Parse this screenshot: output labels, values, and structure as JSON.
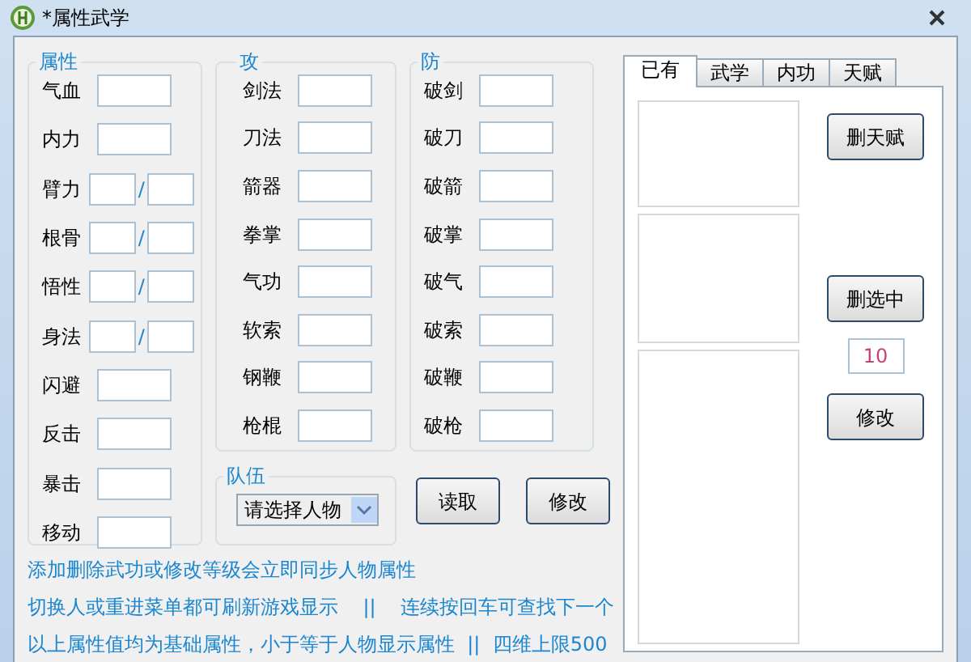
{
  "window": {
    "title": "*属性武学"
  },
  "groups": [
    {
      "title": "属性",
      "rows": [
        {
          "label": "气血",
          "kind": "single"
        },
        {
          "label": "内力",
          "kind": "single"
        },
        {
          "label": "臂力",
          "kind": "pair",
          "separator": "/"
        },
        {
          "label": "根骨",
          "kind": "pair",
          "separator": "/"
        },
        {
          "label": "悟性",
          "kind": "pair",
          "separator": "/"
        },
        {
          "label": "身法",
          "kind": "pair",
          "separator": "/"
        },
        {
          "label": "闪避",
          "kind": "single"
        },
        {
          "label": "反击",
          "kind": "single"
        },
        {
          "label": "暴击",
          "kind": "single"
        },
        {
          "label": "移动",
          "kind": "single"
        }
      ]
    },
    {
      "title": "攻",
      "rows": [
        {
          "label": "剑法",
          "kind": "single"
        },
        {
          "label": "刀法",
          "kind": "single"
        },
        {
          "label": "箭器",
          "kind": "single"
        },
        {
          "label": "拳掌",
          "kind": "single"
        },
        {
          "label": "气功",
          "kind": "single"
        },
        {
          "label": "软索",
          "kind": "single"
        },
        {
          "label": "钢鞭",
          "kind": "single"
        },
        {
          "label": "枪棍",
          "kind": "single"
        }
      ]
    },
    {
      "title": "防",
      "rows": [
        {
          "label": "破剑",
          "kind": "single"
        },
        {
          "label": "破刀",
          "kind": "single"
        },
        {
          "label": "破箭",
          "kind": "single"
        },
        {
          "label": "破掌",
          "kind": "single"
        },
        {
          "label": "破气",
          "kind": "single"
        },
        {
          "label": "破索",
          "kind": "single"
        },
        {
          "label": "破鞭",
          "kind": "single"
        },
        {
          "label": "破枪",
          "kind": "single"
        }
      ]
    }
  ],
  "team": {
    "title": "队伍",
    "select": "请选择人物"
  },
  "buttons": [
    "读取",
    "修改"
  ],
  "notes": [
    "添加删除武功或修改等级会立即同步人物属性",
    "切换人或重进菜单都可刷新游戏显示    ||    连续按回车可查找下一个",
    "以上属性值均为基础属性，小于等于人物显示属性  ||  四维上限500"
  ],
  "tabs": [
    {
      "label": "已有",
      "selected": true
    },
    {
      "label": "武学",
      "selected": false
    },
    {
      "label": "内功",
      "selected": false
    },
    {
      "label": "天赋",
      "selected": false
    }
  ],
  "side": {
    "delete_talent": "删天赋",
    "delete_selected": "删选中",
    "count": "10",
    "modify": "修改"
  }
}
